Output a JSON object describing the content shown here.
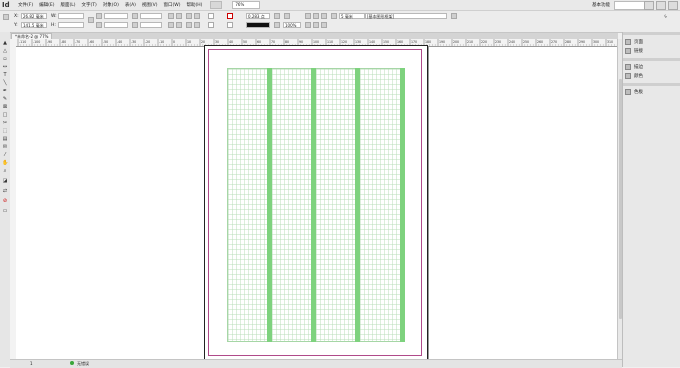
{
  "app": {
    "logo": "Id",
    "menus": [
      "文件(F)",
      "编辑(E)",
      "版面(L)",
      "文字(T)",
      "对象(O)",
      "表(A)",
      "视图(V)",
      "窗口(W)",
      "帮助(H)"
    ],
    "zoom": "76%",
    "workspace": "基本功能"
  },
  "control": {
    "x_label": "X:",
    "y_label": "Y:",
    "w_label": "W:",
    "h_label": "H:",
    "x_value": "26.82 毫米",
    "y_value": "141.5 毫米",
    "stroke_weight": "0.283 点",
    "percent": "100%",
    "frame_style": "[基本图形框架]",
    "dim_value": "5 毫米"
  },
  "document": {
    "tab_label": "*未命名-2 @ 77%",
    "status_page": "1",
    "status_text": "无错误"
  },
  "ruler": {
    "top_ticks": [
      "-110",
      "-100",
      "-90",
      "-80",
      "-70",
      "-60",
      "-50",
      "-40",
      "-30",
      "-20",
      "-10",
      "0",
      "10",
      "20",
      "30",
      "40",
      "50",
      "60",
      "70",
      "80",
      "90",
      "100",
      "110",
      "120",
      "130",
      "140",
      "150",
      "160",
      "170",
      "180",
      "190",
      "200",
      "210",
      "220",
      "230",
      "240",
      "250",
      "260",
      "270",
      "280",
      "290",
      "300",
      "310"
    ]
  },
  "panels": {
    "items": [
      "页面",
      "链接",
      "描边",
      "颜色",
      "色板"
    ]
  },
  "colors": {
    "grid_line": "#b8dcb8",
    "gutter": "#7ed27e",
    "margin": "#b04a8a"
  }
}
